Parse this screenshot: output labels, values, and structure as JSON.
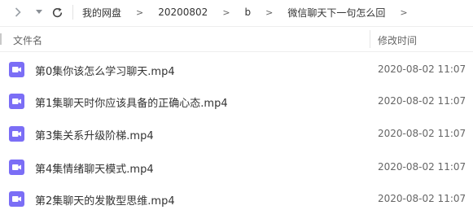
{
  "breadcrumb": {
    "items": [
      "我的网盘",
      "20200802",
      "b",
      "微信聊天下一句怎么回"
    ],
    "separator": ">"
  },
  "header": {
    "name_label": "文件名",
    "time_label": "修改时间"
  },
  "files": [
    {
      "name": "第0集你该怎么学习聊天.mp4",
      "modified": "2020-08-02 11:07",
      "icon": "video-file-icon"
    },
    {
      "name": "第1集聊天时你应该具备的正确心态.mp4",
      "modified": "2020-08-02 11:07",
      "icon": "video-file-icon"
    },
    {
      "name": "第3集关系升级阶梯.mp4",
      "modified": "2020-08-02 11:07",
      "icon": "video-file-icon"
    },
    {
      "name": "第4集情绪聊天模式.mp4",
      "modified": "2020-08-02 11:07",
      "icon": "video-file-icon"
    },
    {
      "name": "第2集聊天的发散型思维.mp4",
      "modified": "2020-08-02 11:07",
      "icon": "video-file-icon"
    }
  ],
  "colors": {
    "video_icon": "#7b6ef6",
    "text": "#333333",
    "muted": "#666666"
  }
}
